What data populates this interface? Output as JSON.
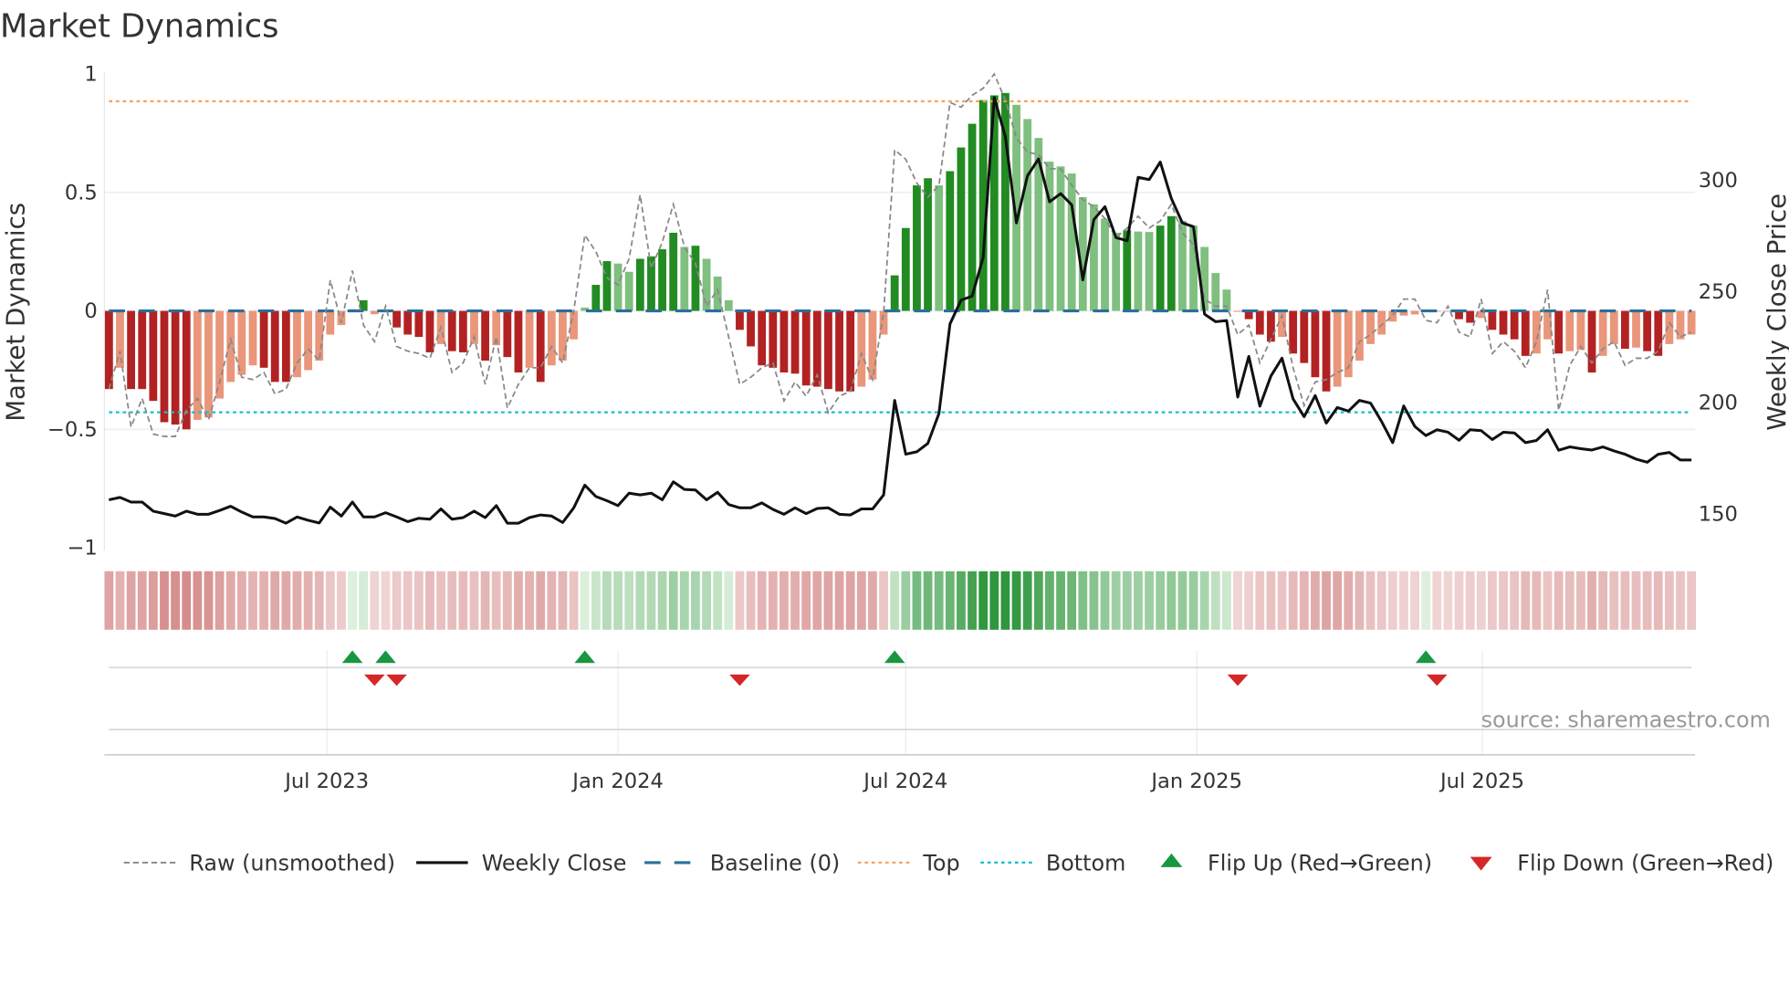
{
  "chart_data": {
    "type": "bar",
    "title": "Market Dynamics",
    "ylabel": "Market Dynamics",
    "y2label": "Weekly Close Price",
    "ylim": [
      -1,
      1
    ],
    "y2lim": [
      134,
      347
    ],
    "yticks": [
      {
        "v": 1,
        "label": "1"
      },
      {
        "v": 0.5,
        "label": "0.5"
      },
      {
        "v": 0,
        "label": "0"
      },
      {
        "v": -0.5,
        "label": "−0.5"
      },
      {
        "v": -1,
        "label": "−1"
      }
    ],
    "y2ticks": [
      {
        "v": 300,
        "label": "300"
      },
      {
        "v": 250,
        "label": "250"
      },
      {
        "v": 200,
        "label": "200"
      },
      {
        "v": 150,
        "label": "150"
      }
    ],
    "xticks": [
      {
        "week": 19.7,
        "label": "Jul 2023"
      },
      {
        "week": 46.0,
        "label": "Jan 2024"
      },
      {
        "week": 72.0,
        "label": "Jul 2024"
      },
      {
        "week": 98.3,
        "label": "Jan 2025"
      },
      {
        "week": 124.1,
        "label": "Jul 2025"
      }
    ],
    "top_level": 0.885,
    "bottom_level": -0.428,
    "baseline": 0,
    "smoothed": [
      -0.33,
      -0.24,
      -0.33,
      -0.33,
      -0.38,
      -0.47,
      -0.48,
      -0.5,
      -0.46,
      -0.45,
      -0.37,
      -0.3,
      -0.27,
      -0.23,
      -0.24,
      -0.3,
      -0.3,
      -0.28,
      -0.25,
      -0.21,
      -0.1,
      -0.06,
      0.007,
      0.045,
      -0.014,
      -0.003,
      -0.07,
      -0.1,
      -0.11,
      -0.175,
      -0.14,
      -0.17,
      -0.175,
      -0.14,
      -0.21,
      -0.145,
      -0.195,
      -0.26,
      -0.24,
      -0.3,
      -0.23,
      -0.21,
      -0.12,
      0.014,
      0.11,
      0.21,
      0.2,
      0.165,
      0.22,
      0.23,
      0.26,
      0.33,
      0.27,
      0.275,
      0.22,
      0.145,
      0.045,
      -0.08,
      -0.15,
      -0.23,
      -0.24,
      -0.26,
      -0.265,
      -0.315,
      -0.32,
      -0.33,
      -0.34,
      -0.34,
      -0.32,
      -0.29,
      -0.1,
      0.15,
      0.35,
      0.53,
      0.56,
      0.53,
      0.59,
      0.69,
      0.79,
      0.89,
      0.91,
      0.92,
      0.87,
      0.81,
      0.73,
      0.63,
      0.61,
      0.58,
      0.48,
      0.45,
      0.39,
      0.33,
      0.34,
      0.335,
      0.333,
      0.36,
      0.4,
      0.38,
      0.36,
      0.27,
      0.16,
      0.09,
      -0.004,
      -0.035,
      -0.1,
      -0.13,
      -0.11,
      -0.18,
      -0.22,
      -0.28,
      -0.34,
      -0.32,
      -0.28,
      -0.21,
      -0.14,
      -0.1,
      -0.045,
      -0.02,
      -0.015,
      0.004,
      -0.003,
      -0.002,
      -0.035,
      -0.05,
      -0.03,
      -0.08,
      -0.1,
      -0.12,
      -0.19,
      -0.18,
      -0.12,
      -0.18,
      -0.17,
      -0.165,
      -0.26,
      -0.19,
      -0.14,
      -0.16,
      -0.155,
      -0.17,
      -0.19,
      -0.14,
      -0.12,
      -0.1
    ],
    "raw": [
      -0.33,
      -0.17,
      -0.49,
      -0.37,
      -0.52,
      -0.53,
      -0.53,
      -0.42,
      -0.37,
      -0.46,
      -0.3,
      -0.12,
      -0.28,
      -0.29,
      -0.26,
      -0.35,
      -0.33,
      -0.22,
      -0.16,
      -0.21,
      0.13,
      -0.05,
      0.17,
      -0.06,
      -0.13,
      0.02,
      -0.15,
      -0.17,
      -0.18,
      -0.2,
      -0.07,
      -0.26,
      -0.22,
      -0.11,
      -0.31,
      -0.11,
      -0.41,
      -0.31,
      -0.24,
      -0.24,
      -0.15,
      -0.22,
      0,
      0.32,
      0.25,
      0.14,
      0.11,
      0.22,
      0.49,
      0.18,
      0.29,
      0.45,
      0.27,
      0.2,
      0.02,
      0.09,
      -0.11,
      -0.31,
      -0.28,
      -0.24,
      -0.22,
      -0.38,
      -0.3,
      -0.36,
      -0.27,
      -0.43,
      -0.36,
      -0.34,
      -0.18,
      -0.29,
      -0.01,
      0.68,
      0.64,
      0.54,
      0.48,
      0.53,
      0.88,
      0.86,
      0.91,
      0.94,
      1.0,
      0.89,
      0.73,
      0.67,
      0.66,
      0.6,
      0.6,
      0.53,
      0.47,
      0.44,
      0.39,
      0.31,
      0.35,
      0.4,
      0.35,
      0.38,
      0.45,
      0.33,
      0.28,
      0.05,
      0.02,
      0.02,
      -0.1,
      -0.06,
      -0.22,
      -0.12,
      -0.02,
      -0.24,
      -0.4,
      -0.3,
      -0.29,
      -0.26,
      -0.24,
      -0.13,
      -0.1,
      -0.06,
      -0.02,
      0.05,
      0.05,
      -0.04,
      -0.05,
      0.02,
      -0.09,
      -0.11,
      0.05,
      -0.18,
      -0.13,
      -0.17,
      -0.24,
      -0.13,
      0.09,
      -0.42,
      -0.23,
      -0.15,
      -0.22,
      -0.16,
      -0.13,
      -0.23,
      -0.2,
      -0.2,
      -0.17,
      -0.05,
      -0.11,
      -0.09
    ],
    "close": [
      155.8,
      156.9,
      154.8,
      154.8,
      150.7,
      149.6,
      148.5,
      150.7,
      149.3,
      149.3,
      151,
      152.9,
      150.3,
      148.1,
      148.1,
      147.4,
      145.3,
      148.1,
      146.6,
      145.4,
      152.5,
      148.5,
      154.8,
      148.1,
      148.1,
      150,
      148.1,
      146,
      147.5,
      147.1,
      151.7,
      147.1,
      147.8,
      150.7,
      147.8,
      153.2,
      145.3,
      145.3,
      147.8,
      149,
      148.5,
      145.6,
      152.2,
      162.4,
      157.3,
      155.4,
      153.2,
      158.8,
      158,
      158.8,
      155.8,
      163.9,
      160.5,
      160.2,
      155.8,
      159.2,
      153.7,
      152.2,
      152.2,
      154.4,
      151.5,
      149.3,
      152.2,
      149.6,
      151.9,
      152.2,
      149.3,
      149,
      151.7,
      151.7,
      158,
      200.5,
      176.3,
      177.4,
      181.2,
      194.6,
      234.9,
      245.6,
      247.4,
      264.9,
      336.7,
      319.1,
      280.3,
      301.5,
      309.1,
      289.8,
      293.5,
      288.4,
      254.7,
      281.8,
      287.6,
      273.7,
      272.3,
      300.8,
      299.8,
      307.7,
      291.3,
      280.3,
      278.6,
      239.3,
      235.9,
      236.4,
      202,
      220.3,
      197.9,
      211.5,
      219.5,
      201.2,
      193.2,
      202.7,
      190.3,
      197.3,
      195.7,
      200.5,
      199.3,
      191,
      181.5,
      198,
      188.8,
      184.7,
      187.3,
      186.2,
      182.6,
      187.3,
      186.9,
      182.9,
      186.2,
      185.9,
      181.5,
      182.5,
      187.3,
      178.1,
      179.6,
      178.8,
      178.2,
      179.6,
      177.8,
      176.3,
      174.1,
      172.7,
      176.3,
      177.1,
      173.7,
      173.7
    ],
    "flip_up_weeks": [
      22,
      25,
      43,
      71,
      119
    ],
    "flip_down_weeks": [
      24,
      26,
      57,
      102,
      120
    ],
    "legend": [
      {
        "key": "raw",
        "label": "Raw (unsmoothed)"
      },
      {
        "key": "close",
        "label": "Weekly Close"
      },
      {
        "key": "baseline",
        "label": "Baseline (0)"
      },
      {
        "key": "top",
        "label": "Top"
      },
      {
        "key": "bottom",
        "label": "Bottom"
      },
      {
        "key": "flip_up",
        "label": "Flip Up (Red→Green)"
      },
      {
        "key": "flip_down",
        "label": "Flip Down (Green→Red)"
      }
    ],
    "legend_position": "bottom",
    "source": "source: sharemaestro.com",
    "colors": {
      "pos_strong": "#228b22",
      "pos_weak": "#7fbf7f",
      "neg_strong": "#b22222",
      "neg_weak": "#e9967a",
      "raw": "#888888",
      "close": "#111111",
      "baseline": "#2a6f9b",
      "top": "#f4a460",
      "bottom": "#17becf",
      "flip_up": "#1a9641",
      "flip_down": "#d62728"
    }
  }
}
